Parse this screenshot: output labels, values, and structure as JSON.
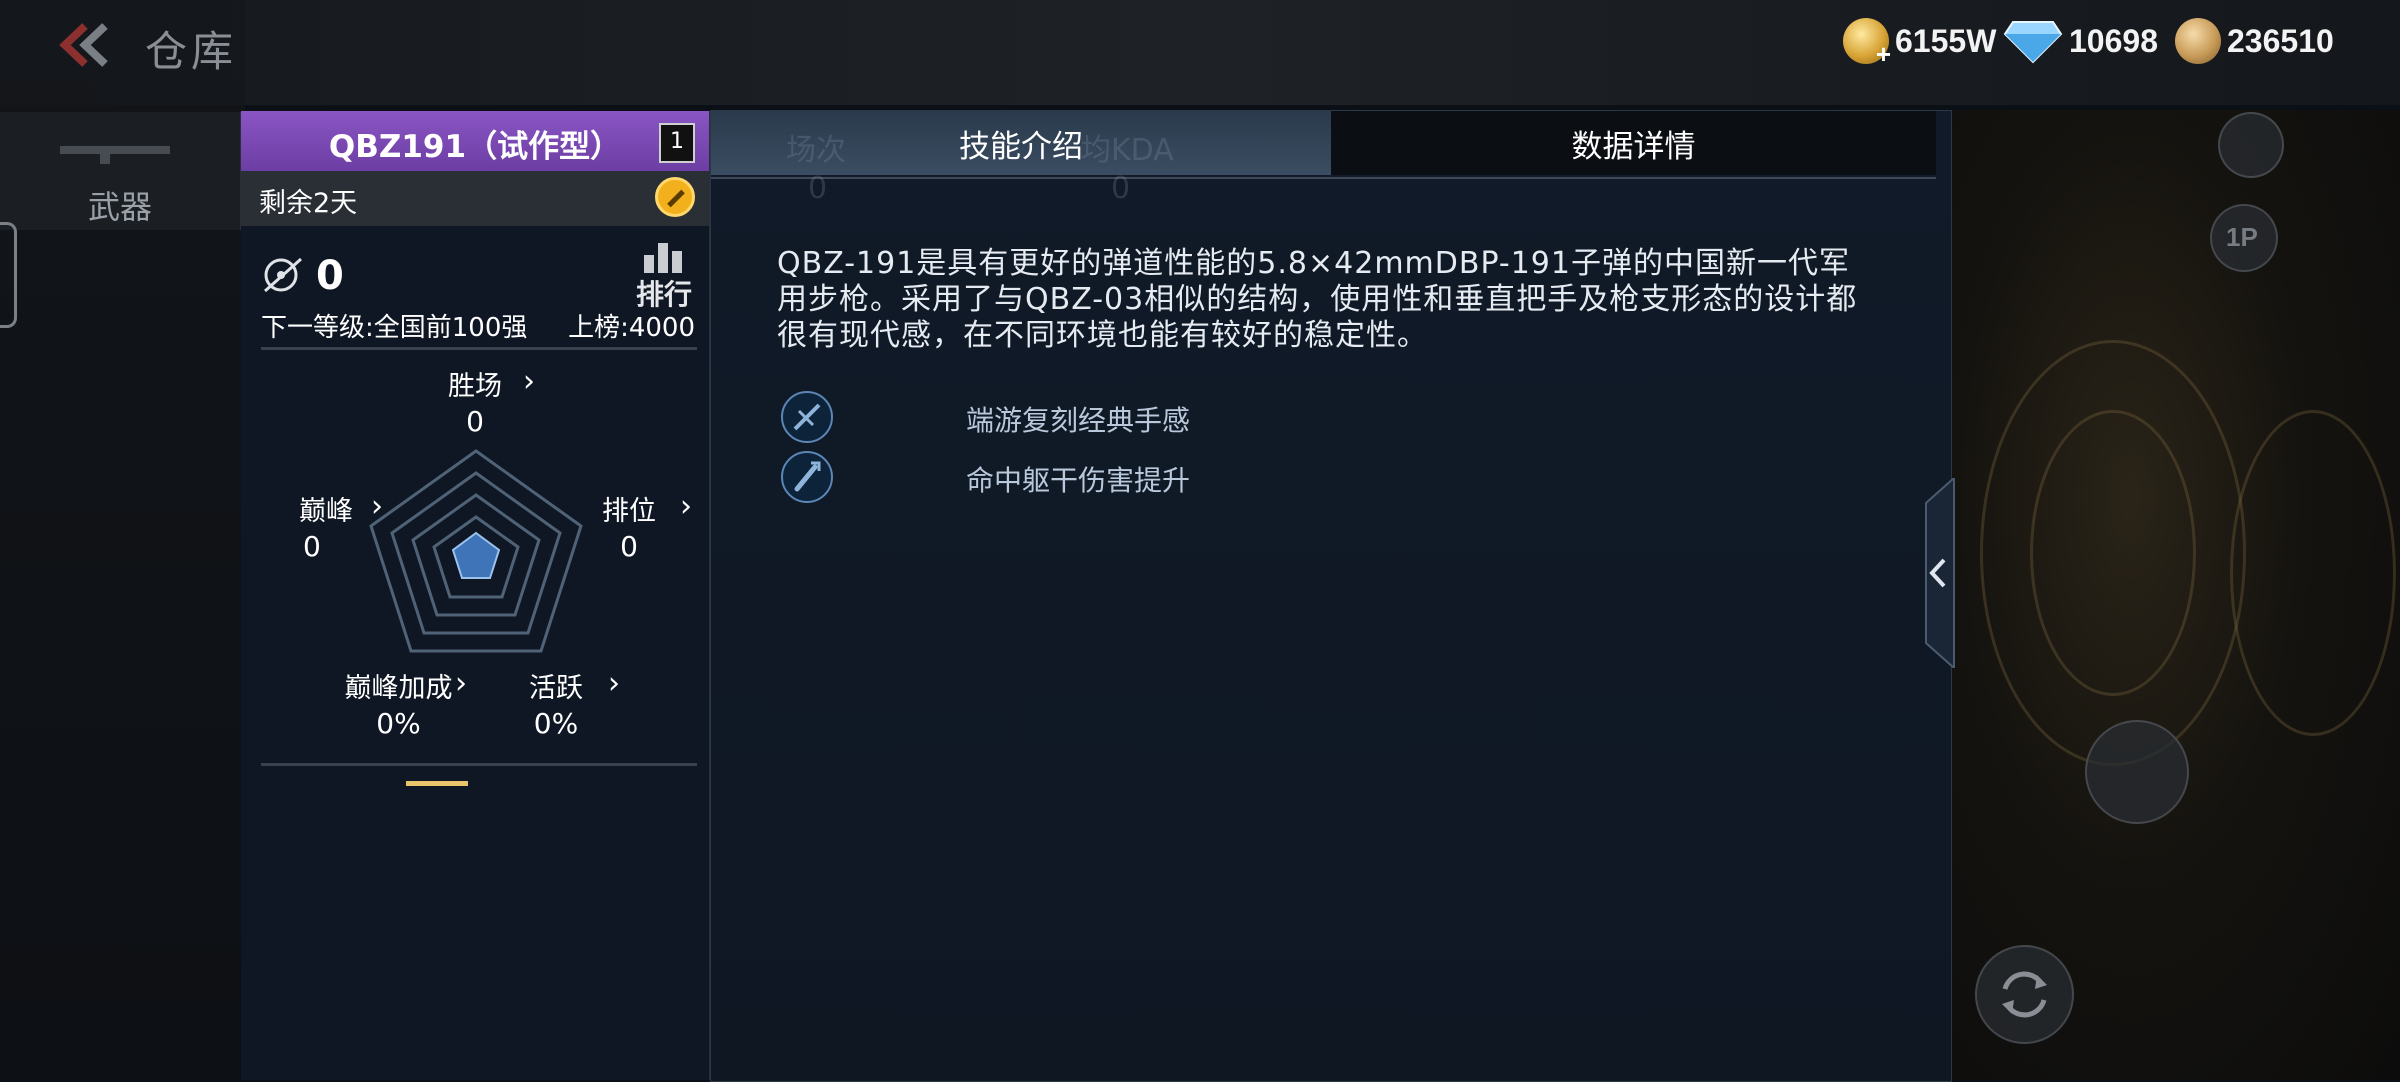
{
  "header": {
    "title": "仓库",
    "currencies": [
      {
        "icon": "gold-coin-icon",
        "value": "6155W"
      },
      {
        "icon": "diamond-icon",
        "value": "10698"
      },
      {
        "icon": "bronze-coin-icon",
        "value": "236510"
      }
    ]
  },
  "sidebar": {
    "weapon_tab_label": "武器"
  },
  "weapon": {
    "name": "QBZ191（试作型）",
    "level": "1",
    "remaining": "剩余2天",
    "kills": "0",
    "rank_label": "排行",
    "next_level": "下一等级:全国前100强",
    "on_board": "上榜:4000",
    "stats": {
      "wins": {
        "label": "胜场",
        "value": "0"
      },
      "peak": {
        "label": "巅峰",
        "value": "0"
      },
      "ranked": {
        "label": "排位",
        "value": "0"
      },
      "peak_bonus": {
        "label": "巅峰加成",
        "value": "0%"
      },
      "active": {
        "label": "活跃",
        "value": "0%"
      }
    }
  },
  "tabs": {
    "skill_intro": "技能介绍",
    "data_details": "数据详情"
  },
  "description": "QBZ-191是具有更好的弹道性能的5.8×42mmDBP-191子弹的中国新一代军用步枪。采用了与QBZ-03相似的结构，使用性和垂直把手及枪支形态的设计都很有现代感，在不同环境也能有较好的稳定性。",
  "skills": [
    {
      "icon": "rifle-skill-icon",
      "text": "端游复刻经典手感"
    },
    {
      "icon": "bullet-skill-icon",
      "text": "命中躯干伤害提升"
    }
  ],
  "ghost_stats": [
    {
      "label": "场次",
      "value": "0"
    },
    {
      "label": "均KDA",
      "value": "0"
    }
  ],
  "colors": {
    "weapon_header": "#7a48b5",
    "active_tab": "#3b4d62",
    "gold": "#e9c46a",
    "panel_bg": "#0f1723"
  }
}
